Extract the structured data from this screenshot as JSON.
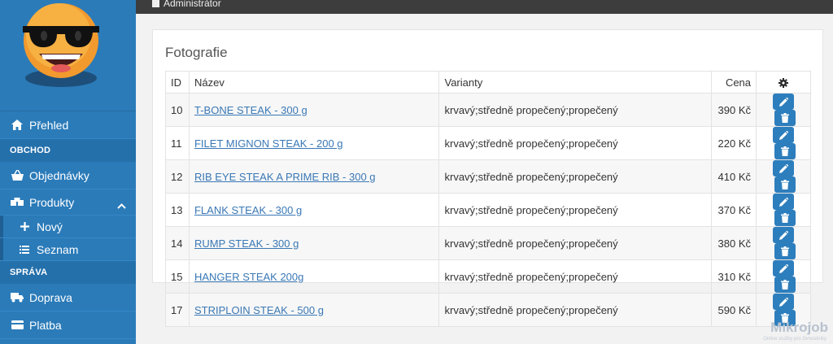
{
  "topbar": {
    "user": "Administrátor"
  },
  "sidebar": {
    "items": [
      {
        "label": "Přehled"
      },
      {
        "section": "OBCHOD"
      },
      {
        "label": "Objednávky"
      },
      {
        "label": "Produkty"
      },
      {
        "label": "Nový"
      },
      {
        "label": "Seznam"
      },
      {
        "section": "SPRÁVA"
      },
      {
        "label": "Doprava"
      },
      {
        "label": "Platba"
      }
    ]
  },
  "panel": {
    "title": "Fotografie",
    "columns": {
      "id": "ID",
      "name": "Název",
      "variants": "Varianty",
      "price": "Cena"
    },
    "rows": [
      {
        "id": "10",
        "name": "T-BONE STEAK - 300 g",
        "variants": "krvavý;středně propečený;propečený",
        "price": "390 Kč"
      },
      {
        "id": "11",
        "name": "FILET MIGNON STEAK - 200 g",
        "variants": "krvavý;středně propečený;propečený",
        "price": "220 Kč"
      },
      {
        "id": "12",
        "name": "RIB EYE STEAK A PRIME RIB - 300 g",
        "variants": "krvavý;středně propečený;propečený",
        "price": "410 Kč"
      },
      {
        "id": "13",
        "name": "FLANK STEAK - 300 g",
        "variants": "krvavý;středně propečený;propečený",
        "price": "370 Kč"
      },
      {
        "id": "14",
        "name": "RUMP STEAK - 300 g",
        "variants": "krvavý;středně propečený;propečený",
        "price": "380 Kč"
      },
      {
        "id": "15",
        "name": "HANGER STEAK 200g",
        "variants": "krvavý;středně propečený;propečený",
        "price": "310 Kč"
      },
      {
        "id": "17",
        "name": "STRIPLOIN STEAK - 500 g",
        "variants": "krvavý;středně propečený;propečený",
        "price": "590 Kč"
      }
    ]
  },
  "watermark": {
    "brand": "Mikrojob",
    "tagline": "Online služby pro živnostníky"
  },
  "colors": {
    "sidebar": "#2b7bb9",
    "button": "#2d7ebd",
    "link": "#3a78b5",
    "topbar": "#3d3d3d"
  }
}
